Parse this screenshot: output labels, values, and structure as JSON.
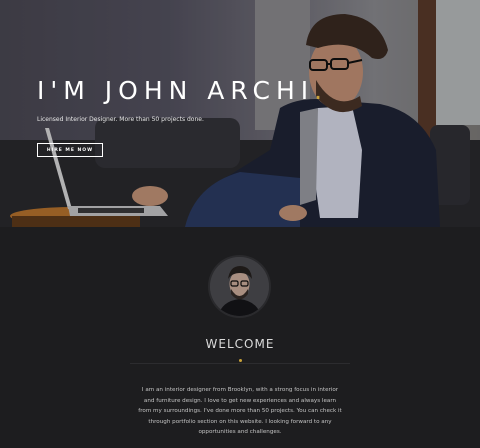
{
  "hero": {
    "title": "I'M JOHN ARCHI",
    "title_dot": ".",
    "subtitle": "Licensed Interior Designer. More than 50 projects done.",
    "button_label": "HIRE ME NOW"
  },
  "about": {
    "heading": "WELCOME",
    "bio": "I am an interior designer from Brooklyn, with a strong focus in interior and furniture design. I love to get new experiences and always learn from my surroundings. I've done more than 50 projects. You can check it through portfolio section on this website. I looking forward to any opportunities and challenges."
  },
  "colors": {
    "accent": "#c9a23a",
    "page_background": "#1d1d1f",
    "hero_text": "#ffffff"
  }
}
